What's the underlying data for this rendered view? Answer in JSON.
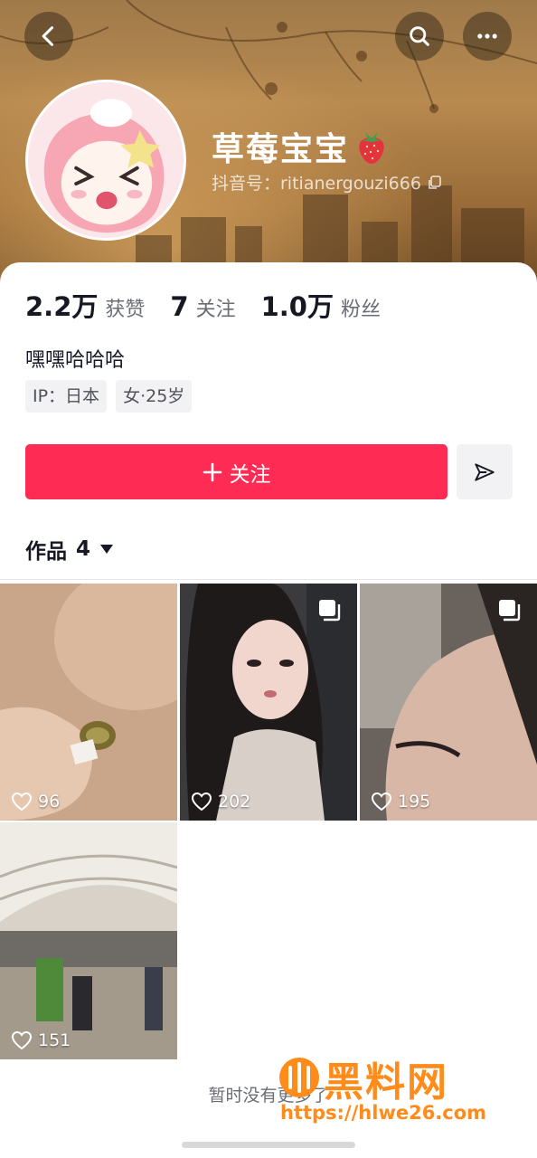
{
  "profile": {
    "name": "草莓宝宝",
    "name_emoji_icon": "strawberry-icon",
    "id_text": "抖音号：ritianergouzi666",
    "bio": "嘿嘿哈哈哈",
    "tags": [
      "IP：日本",
      "女·25岁"
    ]
  },
  "stats": [
    {
      "value": "2.2万",
      "label": "获赞"
    },
    {
      "value": "7",
      "label": "关注"
    },
    {
      "value": "1.0万",
      "label": "粉丝"
    }
  ],
  "actions": {
    "follow_label": "关注",
    "share_icon": "send-icon"
  },
  "header_icons": [
    "back-icon",
    "search-icon",
    "more-icon"
  ],
  "works": {
    "label": "作品",
    "count": "4",
    "items": [
      {
        "likes": "96",
        "multi": false
      },
      {
        "likes": "202",
        "multi": true
      },
      {
        "likes": "195",
        "multi": true
      },
      {
        "likes": "151",
        "multi": false
      }
    ]
  },
  "footer": {
    "text": "暂时没有更多了"
  },
  "watermark": {
    "title": "黑料网",
    "url": "https://hlwe26.com"
  },
  "colors": {
    "accent": "#fe2c55",
    "watermark": "#ff8c1a"
  }
}
